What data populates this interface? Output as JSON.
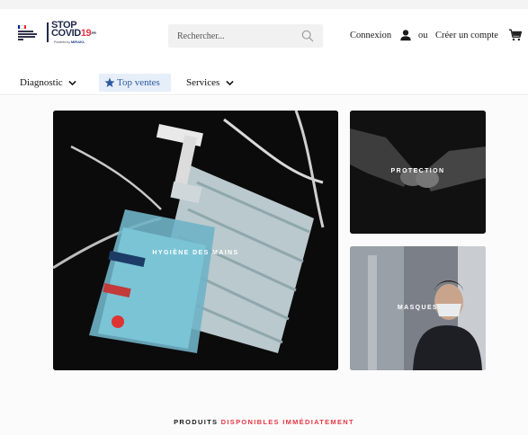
{
  "logo": {
    "brand_line1": "STOP",
    "brand_line2_prefix": "COVID",
    "brand_line2_number": "19",
    "brand_suffix": ".FR",
    "powered_by": "Powered by",
    "powered_brand": "MIRAKL"
  },
  "search": {
    "placeholder": "Rechercher..."
  },
  "account": {
    "login_label": "Connexion",
    "or_label": "ou",
    "signup_label": "Créer un compte"
  },
  "nav": {
    "items": [
      {
        "label": "Diagnostic",
        "has_dropdown": true
      },
      {
        "label": "Top ventes",
        "icon": "star-icon",
        "active": true
      },
      {
        "label": "Services",
        "has_dropdown": true
      }
    ]
  },
  "tiles": [
    {
      "label": "HYGIÈNE DES MAINS"
    },
    {
      "label": "PROTECTION"
    },
    {
      "label": "MASQUES"
    }
  ],
  "section": {
    "title_prefix": "PRODUITS",
    "title_accent": "DISPONIBLES IMMÉDIATEMENT"
  },
  "colors": {
    "accent_red": "#e63946",
    "nav_active_bg": "#e6eef9",
    "nav_active_text": "#2c5aa0",
    "brand_navy": "#1f2a4a"
  },
  "icons": [
    "search-icon",
    "user-icon",
    "cart-icon",
    "star-icon",
    "chevron-down-icon"
  ]
}
